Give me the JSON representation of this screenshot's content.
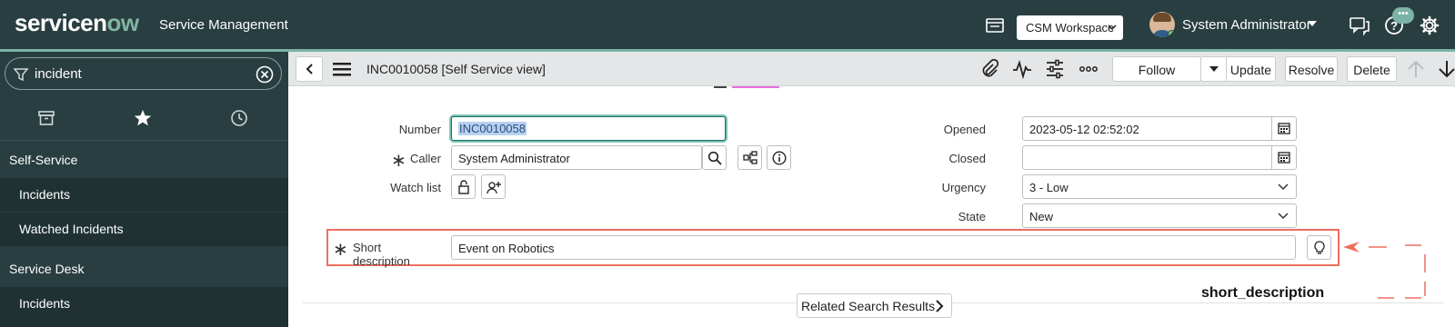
{
  "header": {
    "logo_prefix": "servicen",
    "logo_now": "ow",
    "app_title": "Service Management",
    "workspace_select": "CSM Workspace",
    "user_name": "System Administrator",
    "chat_badge": "•••"
  },
  "nav": {
    "filter_value": "incident",
    "items": [
      {
        "label": "Self-Service",
        "type": "section"
      },
      {
        "label": "Incidents",
        "type": "child"
      },
      {
        "label": "Watched Incidents",
        "type": "child"
      },
      {
        "label": "Service Desk",
        "type": "section"
      },
      {
        "label": "Incidents",
        "type": "child"
      }
    ]
  },
  "form_header": {
    "record_title": "INC0010058 [Self Service view]",
    "follow_label": "Follow",
    "update_label": "Update",
    "resolve_label": "Resolve",
    "delete_label": "Delete"
  },
  "form": {
    "number": {
      "label": "Number",
      "value": "INC0010058"
    },
    "caller": {
      "label": "Caller",
      "value": "System Administrator"
    },
    "watch_list": {
      "label": "Watch list"
    },
    "short_description": {
      "label": "Short description",
      "value": "Event on Robotics"
    },
    "opened": {
      "label": "Opened",
      "value": "2023-05-12 02:52:02"
    },
    "closed": {
      "label": "Closed",
      "value": ""
    },
    "urgency": {
      "label": "Urgency",
      "value": "3 - Low"
    },
    "state": {
      "label": "State",
      "value": "New"
    },
    "mandatory_marker": "∗"
  },
  "related_search": {
    "label": "Related Search Results"
  },
  "annotation": {
    "label": "short_description",
    "color": "#ee6e5e"
  },
  "colors": {
    "banner": "#293e40",
    "accent": "#7bb3a6",
    "nav_child": "#1f3133"
  }
}
